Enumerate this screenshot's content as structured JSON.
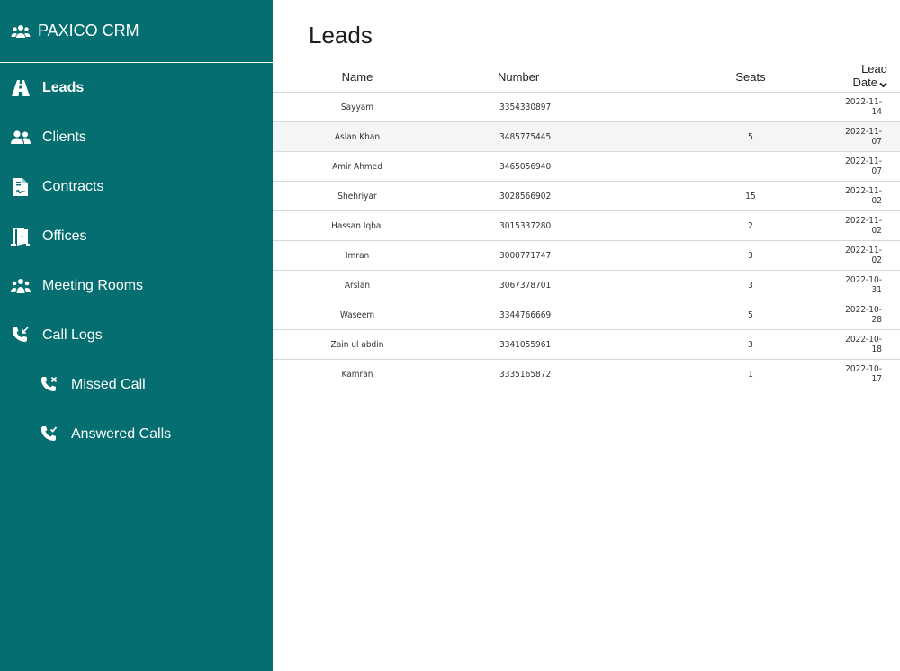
{
  "app": {
    "brand": "PAXICO CRM"
  },
  "sidebar": {
    "items": [
      {
        "label": "Leads",
        "icon": "road-icon",
        "active": true
      },
      {
        "label": "Clients",
        "icon": "users-icon"
      },
      {
        "label": "Contracts",
        "icon": "file-contract-icon"
      },
      {
        "label": "Offices",
        "icon": "door-open-icon"
      },
      {
        "label": "Meeting Rooms",
        "icon": "people-group-icon"
      },
      {
        "label": "Call Logs",
        "icon": "phone-incoming-icon"
      },
      {
        "label": "Missed Call",
        "icon": "phone-missed-icon",
        "sub": true
      },
      {
        "label": "Answered Calls",
        "icon": "phone-answered-icon",
        "sub": true
      }
    ]
  },
  "main": {
    "title": "Leads",
    "columns": [
      "Name",
      "Number",
      "Seats",
      "Lead Date"
    ],
    "rows": [
      {
        "name": "Sayyam",
        "number": "3354330897",
        "seats": "",
        "date": "2022-11-14"
      },
      {
        "name": "Aslan Khan",
        "number": "3485775445",
        "seats": "5",
        "date": "2022-11-07"
      },
      {
        "name": "Amir Ahmed",
        "number": "3465056940",
        "seats": "",
        "date": "2022-11-07"
      },
      {
        "name": "Shehriyar",
        "number": "3028566902",
        "seats": "15",
        "date": "2022-11-02"
      },
      {
        "name": "Hassan Iqbal",
        "number": "3015337280",
        "seats": "2",
        "date": "2022-11-02"
      },
      {
        "name": "Imran",
        "number": "3000771747",
        "seats": "3",
        "date": "2022-11-02"
      },
      {
        "name": "Arslan",
        "number": "3067378701",
        "seats": "3",
        "date": "2022-10-31"
      },
      {
        "name": "Waseem",
        "number": "3344766669",
        "seats": "5",
        "date": "2022-10-28"
      },
      {
        "name": "Zain ul abdin",
        "number": "3341055961",
        "seats": "3",
        "date": "2022-10-18"
      },
      {
        "name": "Kamran",
        "number": "3335165872",
        "seats": "1",
        "date": "2022-10-17"
      }
    ]
  },
  "colors": {
    "sidebar_bg": "#056E70",
    "row_alt": "#f5f5f5"
  }
}
